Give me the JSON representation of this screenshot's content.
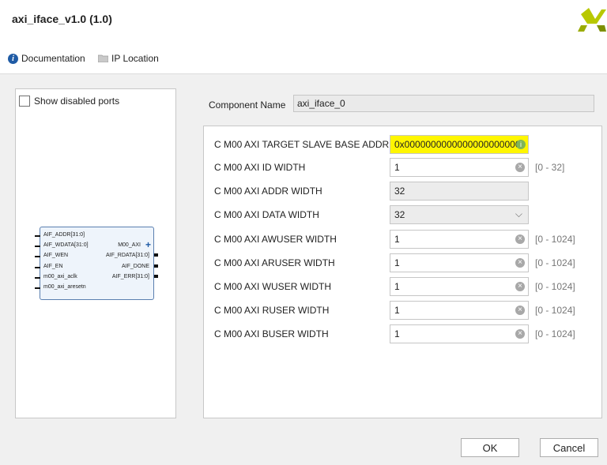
{
  "window": {
    "title": "axi_iface_v1.0 (1.0)"
  },
  "toolbar": {
    "documentation": {
      "label": "Documentation",
      "icon": "info-icon"
    },
    "ip_location": {
      "label": "IP Location",
      "icon": "folder-icon"
    }
  },
  "left": {
    "show_disabled_ports": "Show disabled ports",
    "block": {
      "left_ports": [
        "AIF_ADDR[31:0]",
        "AIF_WDATA[31:0]",
        "AIF_WEN",
        "AIF_EN",
        "m00_axi_aclk",
        "m00_axi_aresetn"
      ],
      "right_ports": [
        "M00_AXI",
        "AIF_RDATA[31:0]",
        "AIF_DONE",
        "AIF_ERR[31:0]"
      ]
    }
  },
  "component": {
    "label": "Component Name",
    "value": "axi_iface_0"
  },
  "params": [
    {
      "label": "C M00 AXI TARGET SLAVE BASE ADDR",
      "value": "0x0000000000000000000000",
      "range": ""
    },
    {
      "label": "C M00 AXI ID WIDTH",
      "value": "1",
      "range": "[0 - 32]"
    },
    {
      "label": "C M00 AXI ADDR WIDTH",
      "value": "32",
      "range": ""
    },
    {
      "label": "C M00 AXI DATA WIDTH",
      "value": "32",
      "range": ""
    },
    {
      "label": "C M00 AXI AWUSER WIDTH",
      "value": "1",
      "range": "[0 - 1024]"
    },
    {
      "label": "C M00 AXI ARUSER WIDTH",
      "value": "1",
      "range": "[0 - 1024]"
    },
    {
      "label": "C M00 AXI WUSER WIDTH",
      "value": "1",
      "range": "[0 - 1024]"
    },
    {
      "label": "C M00 AXI RUSER WIDTH",
      "value": "1",
      "range": "[0 - 1024]"
    },
    {
      "label": "C M00 AXI BUSER WIDTH",
      "value": "1",
      "range": "[0 - 1024]"
    }
  ],
  "buttons": {
    "ok": "OK",
    "cancel": "Cancel"
  },
  "colors": {
    "highlight": "#fff600",
    "accent": "#1f5ba5",
    "logo": "#b8c800"
  }
}
